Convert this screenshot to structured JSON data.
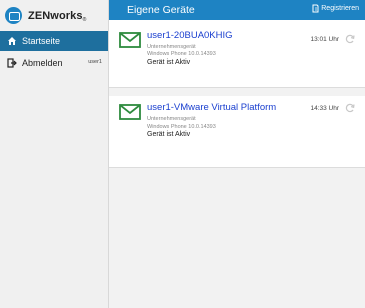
{
  "brand": {
    "name": "ZENworks",
    "mark": "®"
  },
  "sidebar": {
    "items": [
      {
        "label": "Startseite",
        "icon": "home-icon"
      },
      {
        "label": "Abmelden",
        "icon": "logout-icon",
        "user": "user1"
      }
    ]
  },
  "header": {
    "title": "Eigene Geräte",
    "register_label": "Registrieren"
  },
  "devices": [
    {
      "name": "user1-20BUA0KHIG",
      "type": "Unternehmensgerät",
      "os": "Windows Phone 10.0.14393",
      "status": "Gerät ist Aktiv",
      "time": "13:01 Uhr"
    },
    {
      "name": "user1-VMware Virtual Platform",
      "type": "Unternehmensgerät",
      "os": "Windows Phone 10.0.14393",
      "status": "Gerät ist Aktiv",
      "time": "14:33 Uhr"
    }
  ],
  "colors": {
    "accent": "#1e83c3",
    "nav_active": "#1e6f9e",
    "device_name": "#1a3fcf",
    "mail_icon": "#2e8b3e"
  }
}
